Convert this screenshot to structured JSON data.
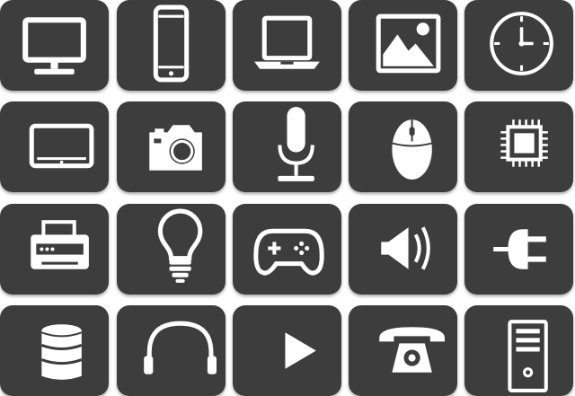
{
  "colors": {
    "background": "#ffffff",
    "tile": "#3d3d3d",
    "icon": "#ffffff"
  },
  "rows": [
    [
      {
        "icon": "monitor-icon"
      },
      {
        "icon": "smartphone-icon"
      },
      {
        "icon": "laptop-icon"
      },
      {
        "icon": "image-icon"
      },
      {
        "icon": "clock-icon"
      }
    ],
    [
      {
        "icon": "tablet-icon"
      },
      {
        "icon": "camera-icon"
      },
      {
        "icon": "microphone-icon"
      },
      {
        "icon": "mouse-icon"
      },
      {
        "icon": "cpu-chip-icon"
      }
    ],
    [
      {
        "icon": "printer-icon"
      },
      {
        "icon": "light-bulb-icon"
      },
      {
        "icon": "game-controller-icon"
      },
      {
        "icon": "speaker-volume-icon"
      },
      {
        "icon": "power-plug-icon"
      }
    ],
    [
      {
        "icon": "database-icon"
      },
      {
        "icon": "headphones-icon"
      },
      {
        "icon": "play-icon"
      },
      {
        "icon": "telephone-icon"
      },
      {
        "icon": "desktop-tower-icon"
      }
    ]
  ]
}
